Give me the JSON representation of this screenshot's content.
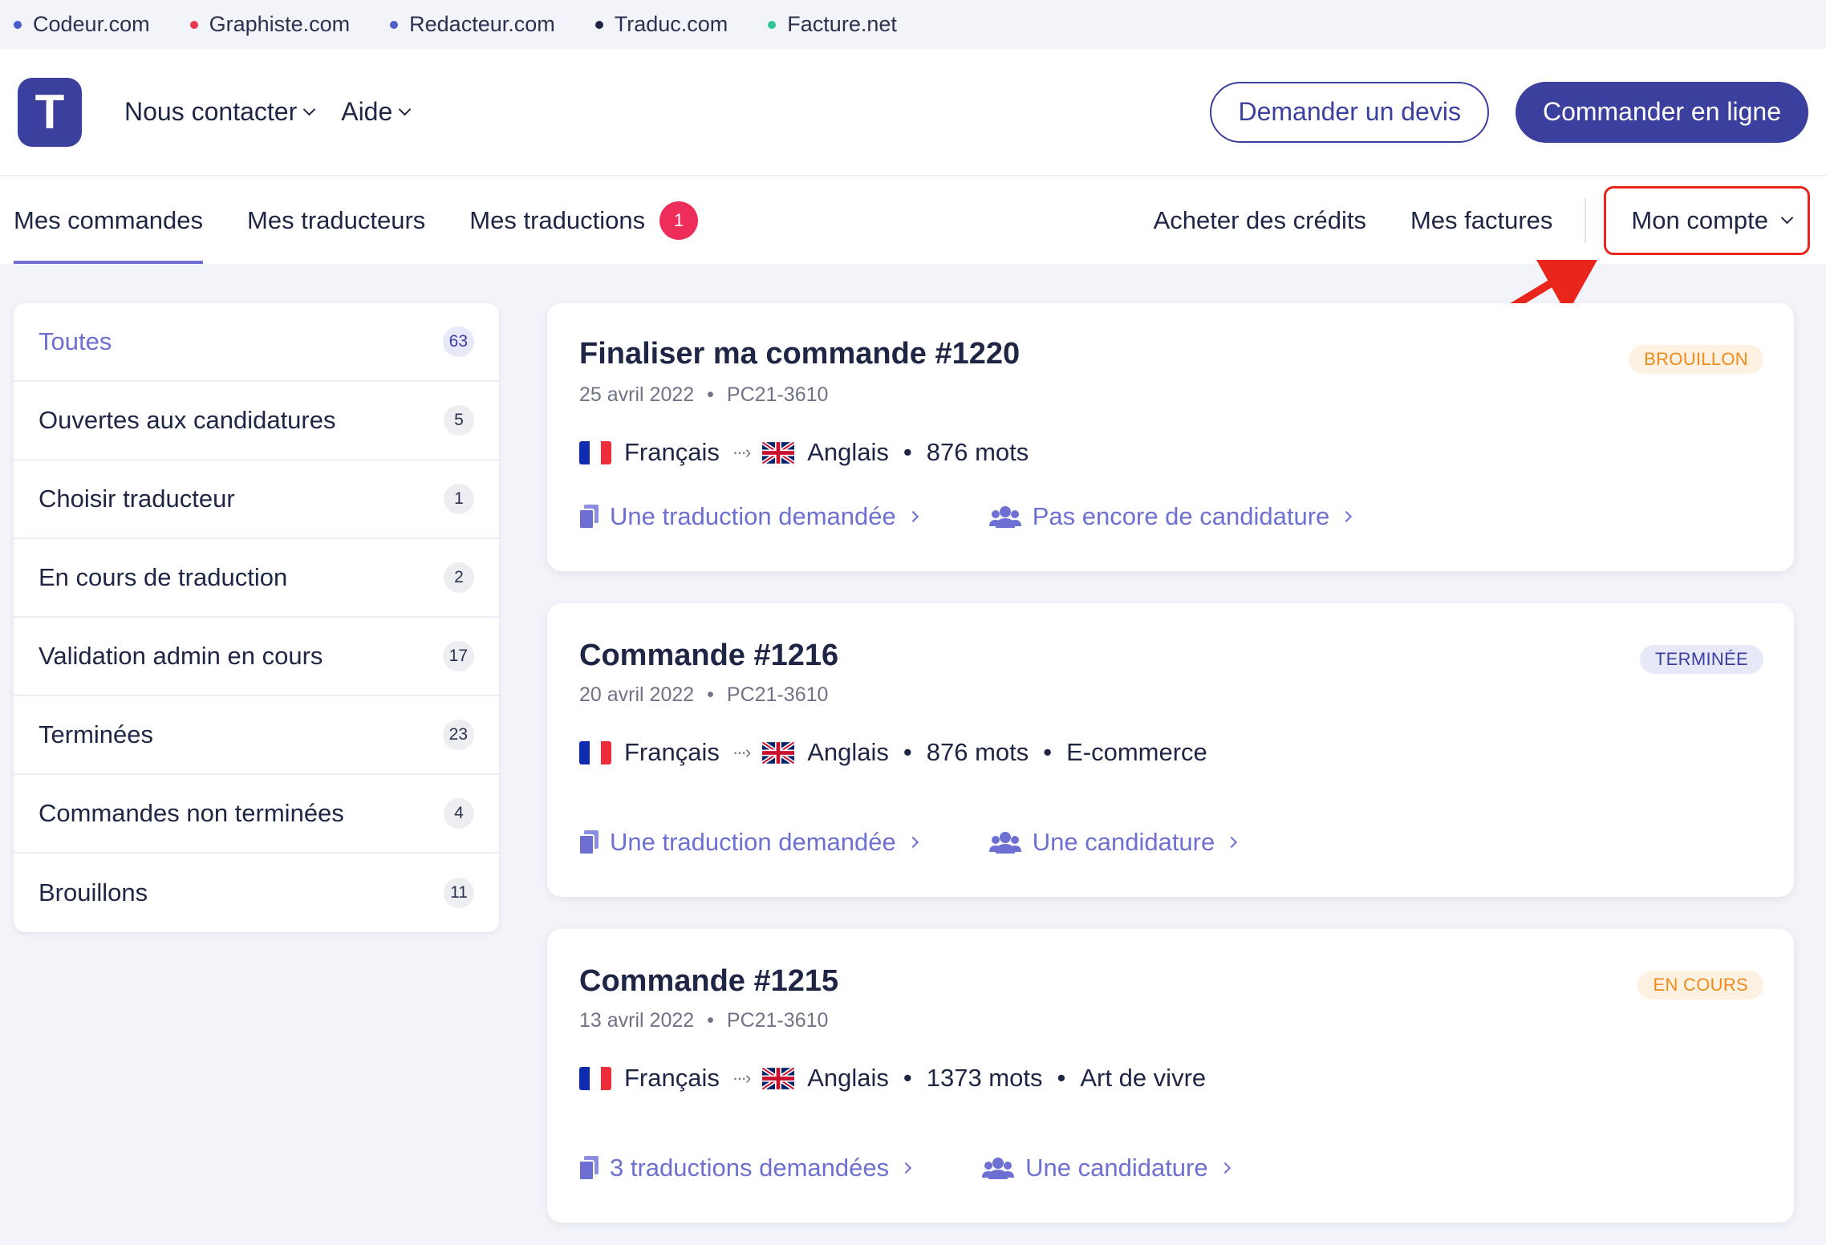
{
  "network": [
    {
      "label": "Codeur.com",
      "color": "#4a5cc9"
    },
    {
      "label": "Graphiste.com",
      "color": "#e9384e"
    },
    {
      "label": "Redacteur.com",
      "color": "#5060c8"
    },
    {
      "label": "Traduc.com",
      "color": "#1f2544"
    },
    {
      "label": "Facture.net",
      "color": "#2fc59a"
    }
  ],
  "header": {
    "logo_letter": "T",
    "menu": [
      {
        "label": "Nous contacter"
      },
      {
        "label": "Aide"
      }
    ],
    "quote_button": "Demander un devis",
    "order_button": "Commander en ligne"
  },
  "nav": {
    "tabs": [
      {
        "label": "Mes commandes",
        "active": true
      },
      {
        "label": "Mes traducteurs"
      },
      {
        "label": "Mes traductions",
        "badge": "1"
      }
    ],
    "right": [
      {
        "label": "Acheter des crédits"
      },
      {
        "label": "Mes factures"
      }
    ],
    "account": "Mon compte"
  },
  "sidebar": {
    "items": [
      {
        "label": "Toutes",
        "count": "63",
        "active": true
      },
      {
        "label": "Ouvertes aux candidatures",
        "count": "5"
      },
      {
        "label": "Choisir traducteur",
        "count": "1"
      },
      {
        "label": "En cours de traduction",
        "count": "2"
      },
      {
        "label": "Validation admin en cours",
        "count": "17"
      },
      {
        "label": "Terminées",
        "count": "23"
      },
      {
        "label": "Commandes non terminées",
        "count": "4"
      },
      {
        "label": "Brouillons",
        "count": "11"
      }
    ]
  },
  "orders": [
    {
      "title": "Finaliser ma commande #1220",
      "date": "25 avril 2022",
      "ref": "PC21-3610",
      "status": "BROUILLON",
      "status_kind": "draft",
      "source": "Français",
      "target": "Anglais",
      "words": "876 mots",
      "category": "",
      "translations_link": "Une traduction demandée",
      "applications_link": "Pas encore de candidature"
    },
    {
      "title": "Commande #1216",
      "date": "20 avril 2022",
      "ref": "PC21-3610",
      "status": "TERMINÉE",
      "status_kind": "done",
      "source": "Français",
      "target": "Anglais",
      "words": "876 mots",
      "category": "E-commerce",
      "translations_link": "Une traduction demandée",
      "applications_link": "Une candidature"
    },
    {
      "title": "Commande #1215",
      "date": "13 avril 2022",
      "ref": "PC21-3610",
      "status": "EN COURS",
      "status_kind": "progress",
      "source": "Français",
      "target": "Anglais",
      "words": "1373 mots",
      "category": "Art de vivre",
      "translations_link": "3 traductions demandées",
      "applications_link": "Une candidature"
    }
  ],
  "icons": {
    "document": "documents-icon",
    "users": "users-icon",
    "annotation": "red-arrow-icon"
  },
  "colors": {
    "brand": "#3b3f9e",
    "accent": "#6d70d2",
    "badge": "#ee2d5b",
    "highlight": "#e8261c"
  }
}
